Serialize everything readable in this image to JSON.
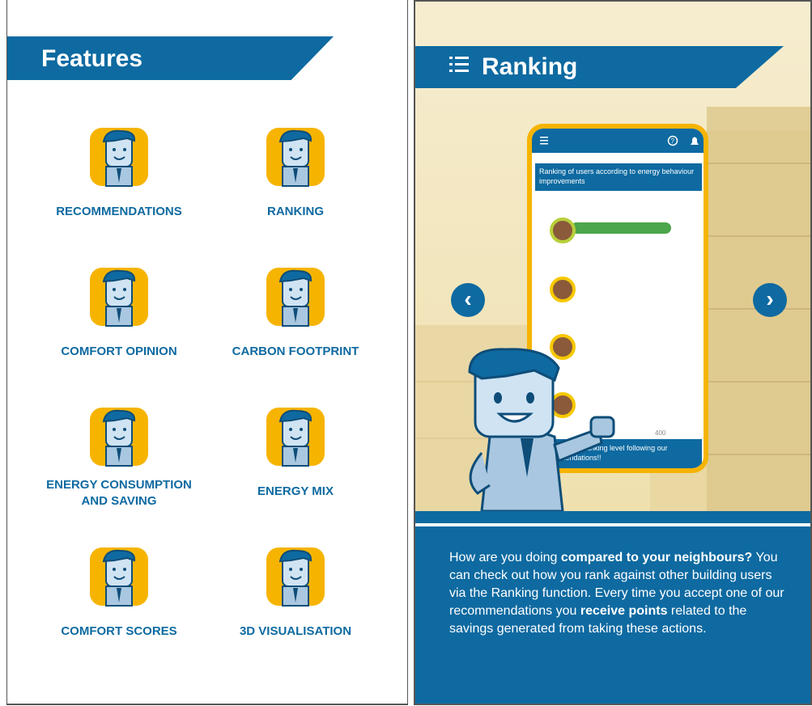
{
  "left": {
    "title": "Features",
    "features": [
      {
        "label": "RECOMMENDATIONS",
        "icon": "character-waving-icon"
      },
      {
        "label": "RANKING",
        "icon": "character-thumbs-up-icon"
      },
      {
        "label": "COMFORT OPINION",
        "icon": "character-holding-paper-icon"
      },
      {
        "label": "CARBON FOOTPRINT",
        "icon": "character-holding-plant-icon"
      },
      {
        "label": "ENERGY CONSUMPTION",
        "label2": "AND SAVING",
        "icon": "character-clipboard-icon"
      },
      {
        "label": "ENERGY MIX",
        "icon": "character-battery-icon"
      },
      {
        "label": "COMFORT SCORES",
        "icon": "character-arms-crossed-icon"
      },
      {
        "label": "3D VISUALISATION",
        "icon": "character-house-icon"
      }
    ]
  },
  "right": {
    "title": "Ranking",
    "phone": {
      "caption": "Ranking of users according to energy behaviour improvements",
      "tick_label": "400",
      "footer": "Improve your ranking level following our recommendations!!"
    },
    "prev_glyph": "‹",
    "next_glyph": "›",
    "description": {
      "p1": "How are you doing ",
      "p1_bold": "compared to your neighbours?",
      "p2": " You can check out how you rank against other building users via the Ranking function. Every time you accept one of our recommendations you ",
      "p2_bold": "receive points",
      "p3": " related to the savings generated from taking these actions."
    }
  },
  "colors": {
    "brand_blue": "#0e6aa1",
    "accent_yellow": "#f6b400",
    "bar_green": "#4ca64b"
  }
}
